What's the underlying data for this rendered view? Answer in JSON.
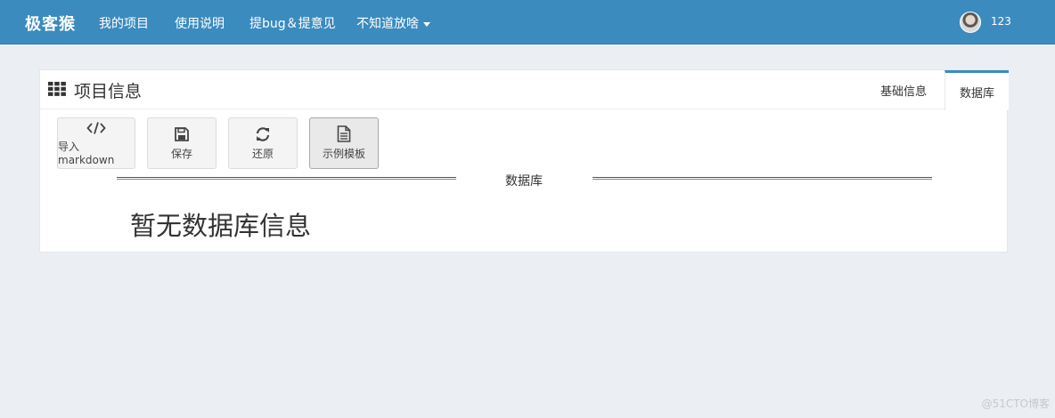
{
  "navbar": {
    "brand": "极客猴",
    "items": [
      "我的项目",
      "使用说明",
      "提bug＆提意见",
      "不知道放啥"
    ],
    "username": "123"
  },
  "panel": {
    "title": "项目信息",
    "tabs": [
      "基础信息",
      "数据库"
    ],
    "active_tab": "数据库",
    "toolbar": {
      "import_label": "导入markdown",
      "save_label": "保存",
      "restore_label": "还原",
      "template_label": "示例模板"
    },
    "section_title": "数据库",
    "empty_message": "暂无数据库信息"
  },
  "watermark": "@51CTO博客",
  "colors": {
    "navbar": "#3b8bbf",
    "background": "#ebeef2"
  }
}
